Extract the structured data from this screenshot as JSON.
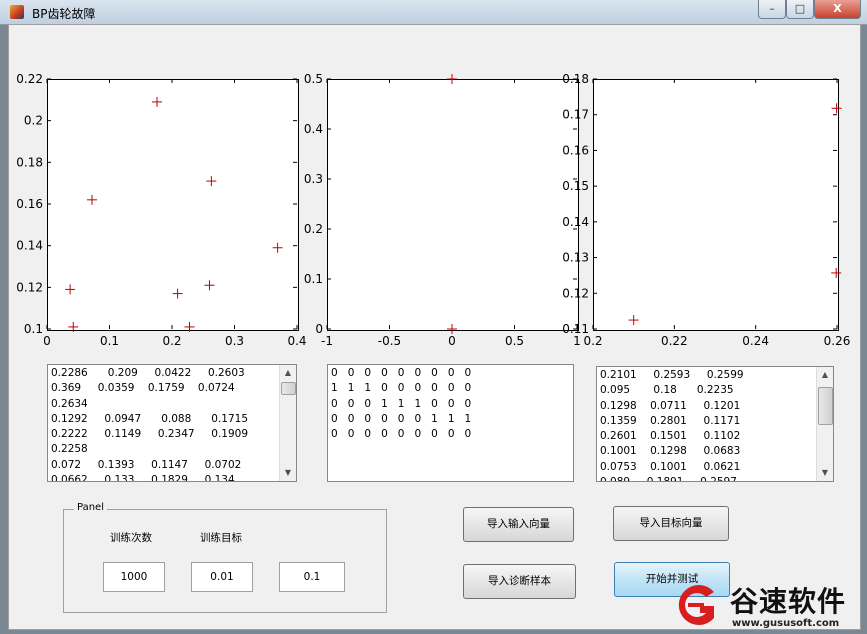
{
  "window": {
    "title": "BP齿轮故障",
    "minimize_label": "–",
    "maximize_label": "□",
    "close_label": "X"
  },
  "chart_data": [
    {
      "type": "scatter",
      "marker": "+",
      "color": "#c00000",
      "xlim": [
        0,
        0.4
      ],
      "ylim": [
        0.1,
        0.22
      ],
      "x_ticks": [
        "0",
        "0.1",
        "0.2",
        "0.3",
        "0.4"
      ],
      "y_ticks": [
        "0.1",
        "0.12",
        "0.14",
        "0.16",
        "0.18",
        "0.2",
        "0.22"
      ],
      "points": [
        {
          "x": 0.037,
          "y": 0.119
        },
        {
          "x": 0.042,
          "y": 0.101
        },
        {
          "x": 0.072,
          "y": 0.162
        },
        {
          "x": 0.176,
          "y": 0.209
        },
        {
          "x": 0.209,
          "y": 0.117
        },
        {
          "x": 0.228,
          "y": 0.101
        },
        {
          "x": 0.26,
          "y": 0.121
        },
        {
          "x": 0.263,
          "y": 0.171
        },
        {
          "x": 0.369,
          "y": 0.139
        }
      ]
    },
    {
      "type": "scatter",
      "marker": "+",
      "color": "#c00000",
      "xlim": [
        -1,
        1
      ],
      "ylim": [
        0,
        0.5
      ],
      "x_ticks": [
        "-1",
        "-0.5",
        "0",
        "0.5",
        "1"
      ],
      "y_ticks": [
        "0",
        "0.1",
        "0.2",
        "0.3",
        "0.4",
        "0.5"
      ],
      "points": [
        {
          "x": 0,
          "y": 0.5
        },
        {
          "x": 0,
          "y": 0
        }
      ]
    },
    {
      "type": "scatter",
      "marker": "+",
      "color": "#c00000",
      "xlim": [
        0.2,
        0.26
      ],
      "ylim": [
        0.11,
        0.18
      ],
      "x_ticks": [
        "0.2",
        "0.22",
        "0.24",
        "0.26"
      ],
      "y_ticks": [
        "0.11",
        "0.12",
        "0.13",
        "0.14",
        "0.15",
        "0.16",
        "0.17",
        "0.18"
      ],
      "tick_label_prefix": "0",
      "points": [
        {
          "x": 0.21,
          "y": 0.1125
        },
        {
          "x": 0.2598,
          "y": 0.1257
        },
        {
          "x": 0.2599,
          "y": 0.1718
        }
      ]
    }
  ],
  "lists": {
    "input_vectors": [
      "0.2286      0.209     0.0422     0.2603",
      "0.369     0.0359    0.1759    0.0724",
      "0.2634",
      "0.1292     0.0947      0.088      0.1715",
      "0.2222     0.1149     0.2347     0.1909",
      "0.2258",
      "0.072     0.1393     0.1147     0.0702",
      "0.0662     0.133     0.1829     0.134"
    ],
    "target_vectors": [
      "0   0   0   0   0   0   0   0   0",
      "1   1   1   0   0   0   0   0   0",
      "0   0   0   1   1   1   0   0   0",
      "0   0   0   0   0   0   1   1   1",
      "0   0   0   0   0   0   0   0   0"
    ],
    "diagnosis_results": [
      "0.2101     0.2593     0.2599",
      "0.095       0.18      0.2235",
      "0.1298    0.0711     0.1201",
      "0.1359    0.2801     0.1171",
      "0.2601    0.1501     0.1102",
      "0.1001    0.1298     0.0683",
      "0.0753    0.1001     0.0621",
      "0.089     0.1891     0.2597"
    ]
  },
  "panel": {
    "title": "Panel",
    "epochs_label": "训练次数",
    "goal_label": "训练目标",
    "epochs_value": "1000",
    "goal_value": "0.01",
    "lr_value": "0.1"
  },
  "buttons": {
    "import_input": "导入输入向量",
    "import_target": "导入目标向量",
    "import_diagnosis": "导入诊断样本",
    "start_test": "开始并测试"
  },
  "watermark": {
    "name": "谷速软件",
    "url": "www.gususoft.com"
  },
  "colors": {
    "marker": "#c00000",
    "watermark_red": "#d81e1e"
  }
}
